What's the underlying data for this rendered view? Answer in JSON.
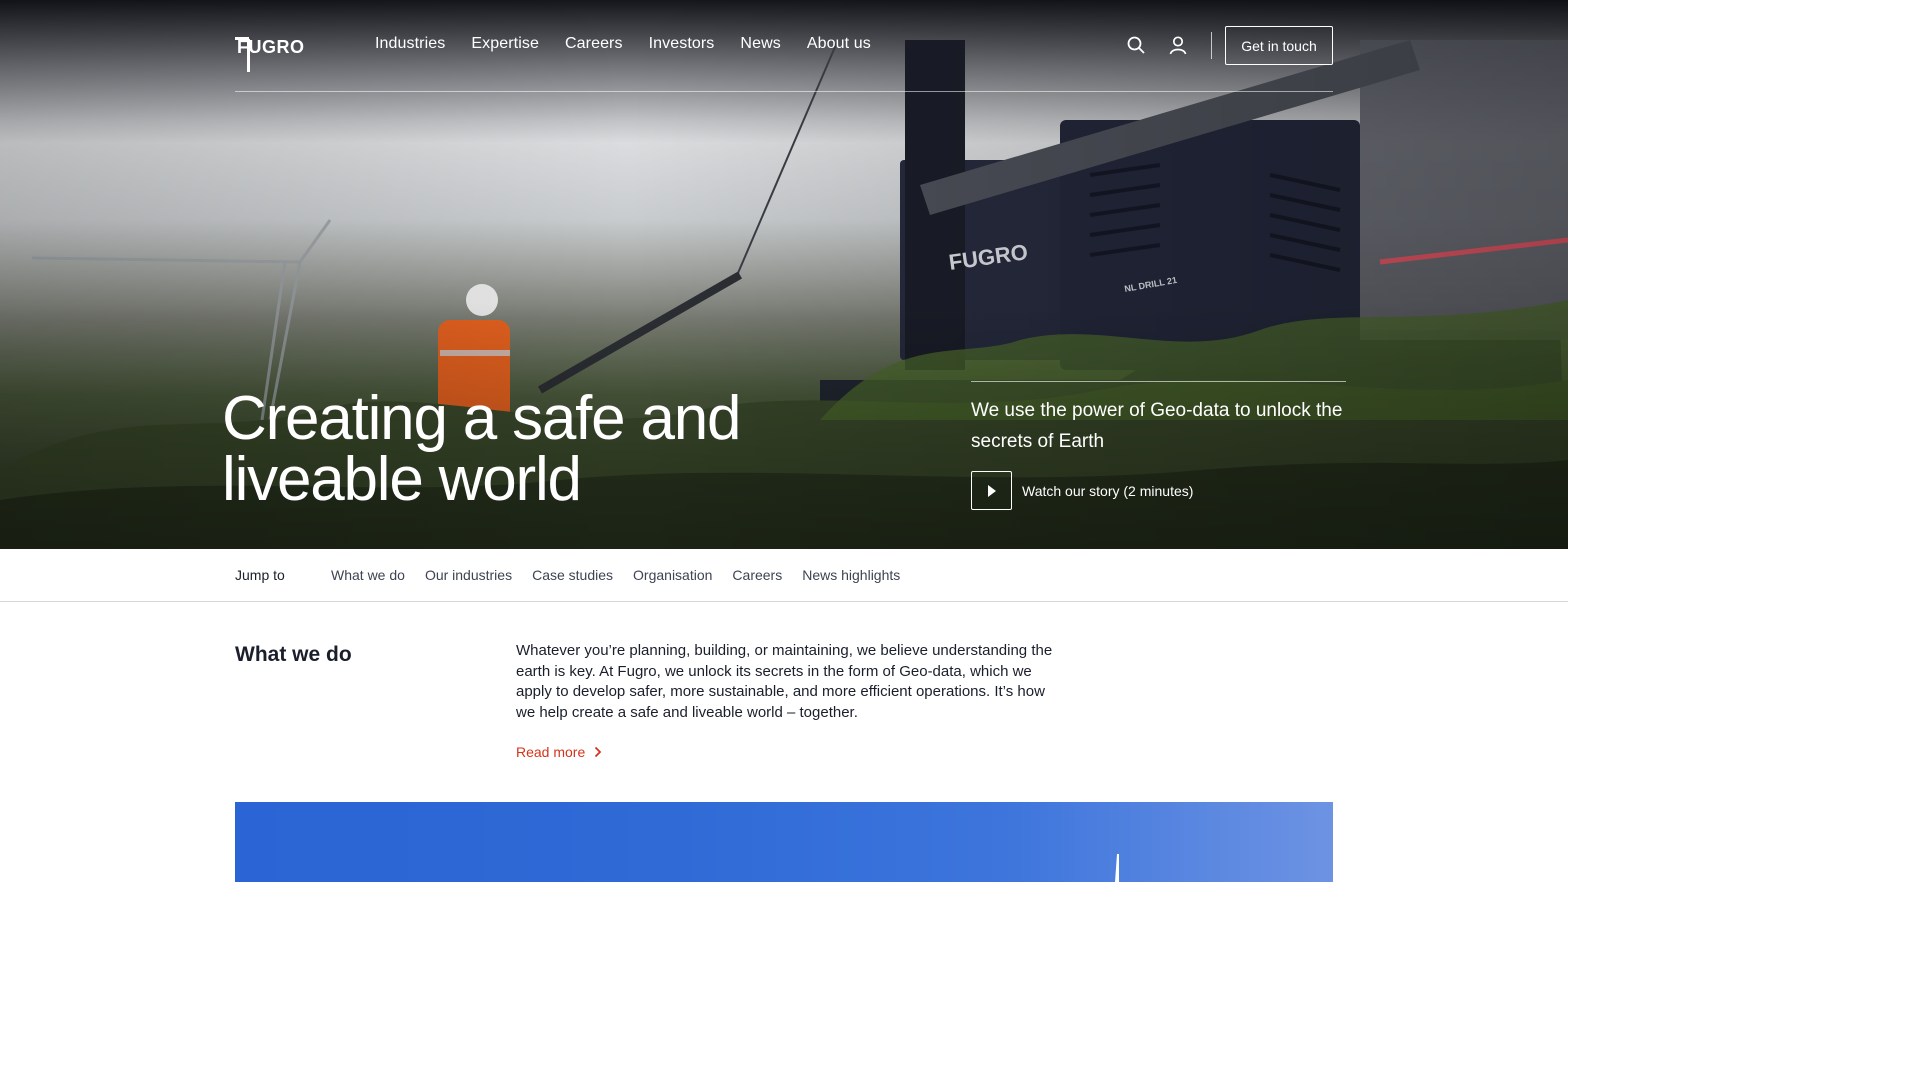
{
  "header": {
    "logo_text": "FUGRO",
    "nav": [
      "Industries",
      "Expertise",
      "Careers",
      "Investors",
      "News",
      "About us"
    ],
    "search_icon": "search-icon",
    "account_icon": "user-icon",
    "cta_label": "Get in touch"
  },
  "hero": {
    "title": "Creating a safe and liveable world",
    "tagline": "We use the power of Geo-data to unlock the secrets of Earth",
    "watch_label": "Watch our story (2 minutes)",
    "play_icon": "play-icon",
    "machine_logo": "FUGRO",
    "machine_label": "NL DRILL 21"
  },
  "jump": {
    "label": "Jump to",
    "links": [
      "What we do",
      "Our industries",
      "Case studies",
      "Organisation",
      "Careers",
      "News highlights"
    ]
  },
  "what_we_do": {
    "title": "What we do",
    "body": "Whatever you’re planning, building, or maintaining, we believe understanding the earth is key. At Fugro, we unlock its secrets in the form of Geo-data, which we apply to develop safer, more sustainable, and more efficient operations. It’s how we help create a safe and liveable world – together.",
    "read_more": "Read more"
  },
  "colors": {
    "accent": "#d4331b",
    "text": "#1a1f2b",
    "hero_text": "#ffffff",
    "sky_blue": "#2f6ad6"
  }
}
